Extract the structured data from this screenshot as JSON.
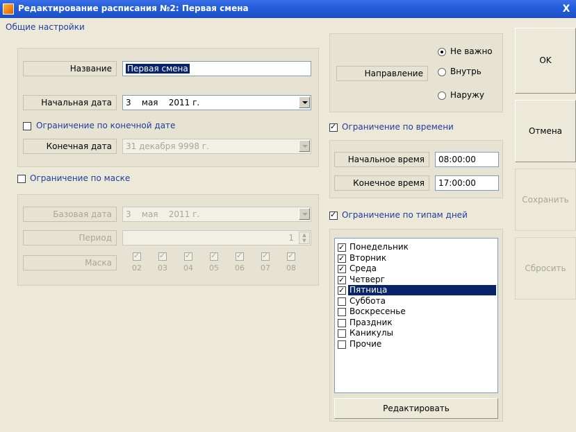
{
  "window": {
    "title": "Редактирование расписания №2: Первая смена",
    "close_label": "X"
  },
  "general": {
    "section_title": "Общие настройки",
    "name_label": "Название",
    "name_value": "Первая смена",
    "start_date_label": "Начальная дата",
    "start_date_value": "3    мая    2011 г.",
    "end_limit_label": "Ограничение по конечной дате",
    "end_limit_checked": false,
    "end_date_label": "Конечная дата",
    "end_date_value": "31 декабря 9998 г."
  },
  "mask": {
    "limit_label": "Ограничение по маске",
    "limit_checked": false,
    "base_date_label": "Базовая дата",
    "base_date_value": "3    мая    2011 г.",
    "period_label": "Период",
    "period_value": "1",
    "mask_label": "Маска",
    "cells": [
      "02",
      "03",
      "04",
      "05",
      "06",
      "07",
      "08"
    ]
  },
  "direction": {
    "label": "Направление",
    "options": [
      {
        "label": "Не важно",
        "selected": true
      },
      {
        "label": "Внутрь",
        "selected": false
      },
      {
        "label": "Наружу",
        "selected": false
      }
    ]
  },
  "time": {
    "limit_label": "Ограничение по времени",
    "limit_checked": true,
    "start_label": "Начальное время",
    "start_value": "08:00:00",
    "end_label": "Конечное время",
    "end_value": "17:00:00"
  },
  "days": {
    "limit_label": "Ограничение по типам дней",
    "limit_checked": true,
    "items": [
      {
        "label": "Понедельник",
        "checked": true
      },
      {
        "label": "Вторник",
        "checked": true
      },
      {
        "label": "Среда",
        "checked": true
      },
      {
        "label": "Четверг",
        "checked": true
      },
      {
        "label": "Пятница",
        "checked": true
      },
      {
        "label": "Суббота",
        "checked": false
      },
      {
        "label": "Воскресенье",
        "checked": false
      },
      {
        "label": "Праздник",
        "checked": false
      },
      {
        "label": "Каникулы",
        "checked": false
      },
      {
        "label": "Прочие",
        "checked": false
      }
    ],
    "edit_button": "Редактировать"
  },
  "buttons": {
    "ok": "OK",
    "cancel": "Отмена",
    "save": "Сохранить",
    "reset": "Сбросить"
  }
}
